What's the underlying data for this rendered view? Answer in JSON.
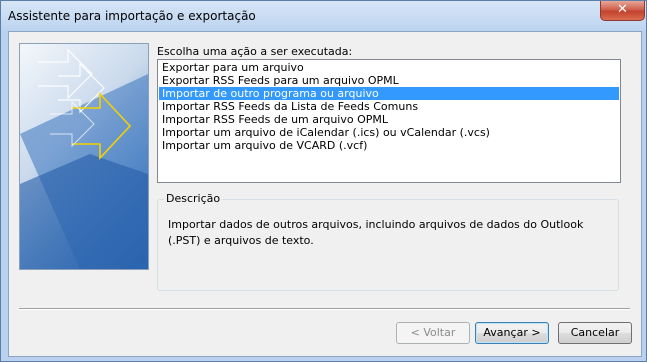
{
  "window": {
    "title": "Assistente para importação e exportação",
    "close_glyph": "✕"
  },
  "main": {
    "action_label": "Escolha uma ação a ser executada:",
    "actions": [
      {
        "label": "Exportar para um arquivo",
        "selected": false
      },
      {
        "label": "Exportar RSS Feeds para um arquivo OPML",
        "selected": false
      },
      {
        "label": "Importar de outro programa ou arquivo",
        "selected": true
      },
      {
        "label": "Importar RSS Feeds da Lista de Feeds Comuns",
        "selected": false
      },
      {
        "label": "Importar RSS Feeds de um arquivo OPML",
        "selected": false
      },
      {
        "label": "Importar um arquivo de iCalendar (.ics) ou vCalendar (.vcs)",
        "selected": false
      },
      {
        "label": "Importar um arquivo de VCARD (.vcf)",
        "selected": false
      }
    ],
    "description": {
      "legend": "Descrição",
      "text": "Importar dados de outros arquivos, incluindo arquivos de dados do Outlook (.PST) e arquivos de texto."
    }
  },
  "buttons": {
    "back": "< Voltar",
    "next": "Avançar >",
    "cancel": "Cancelar"
  },
  "colors": {
    "selection": "#3399ff",
    "banner_arrow": "#f2d200"
  }
}
